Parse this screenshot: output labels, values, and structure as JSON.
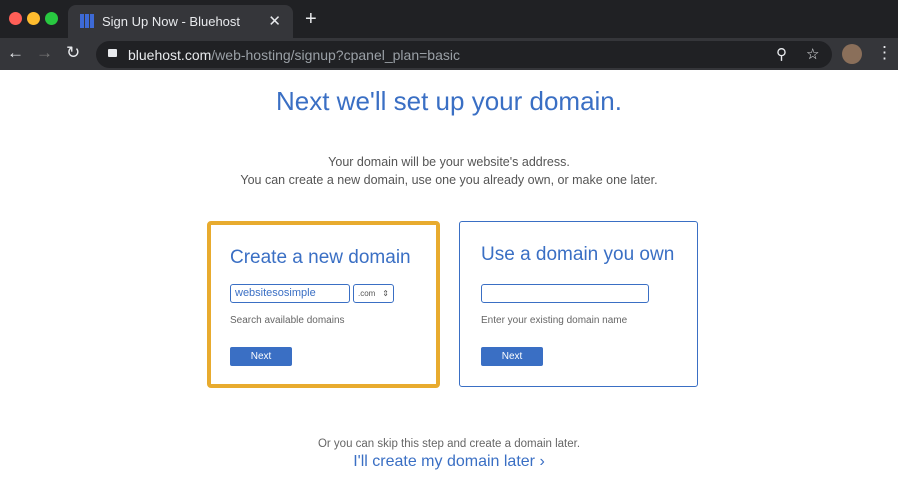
{
  "browser": {
    "tab_title": "Sign Up Now - Bluehost",
    "url_domain": "bluehost.com",
    "url_path": "/web-hosting/signup?cpanel_plan=basic"
  },
  "page": {
    "title": "Next we'll set up your domain.",
    "subtitle_line1": "Your domain will be your website's address.",
    "subtitle_line2": "You can create a new domain, use one you already own, or make one later.",
    "new_domain": {
      "heading": "Create a new domain",
      "value": "websitesosimple",
      "tld": ".com",
      "hint": "Search available domains",
      "button": "Next"
    },
    "own_domain": {
      "heading": "Use a domain you own",
      "value": "",
      "hint": "Enter your existing domain name",
      "button": "Next"
    },
    "skip_text": "Or you can skip this step and create a domain later.",
    "later_link": "I'll create my domain later",
    "colors": {
      "accent": "#3a6fc4",
      "highlight": "#e8ab2e"
    }
  }
}
